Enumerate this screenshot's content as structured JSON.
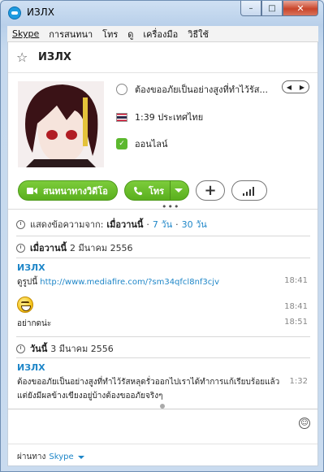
{
  "window": {
    "title": "ИЗЛХ",
    "controls": {
      "minimize": "–",
      "maximize": "□",
      "close": "✕"
    }
  },
  "menu": [
    "Skype",
    "การสนทนา",
    "โทร",
    "ดู",
    "เครื่องมือ",
    "วิธีใช้"
  ],
  "contact": {
    "name": "ИЗЛХ",
    "mood": "ต้องขออภัยเป็นอย่างสูงที่ทำไว้รัส...",
    "local_time": "1:39 ประเทศไทย",
    "status": "ออนไลน์"
  },
  "actions": {
    "video_call": "สนทนาทางวิดีโอ",
    "call": "โทร",
    "add": "+"
  },
  "history": {
    "label": "แสดงข้อความจาก:",
    "selected": "เมื่อวานนี้",
    "opt7": "7 วัน",
    "opt30": "30 วัน"
  },
  "days": [
    {
      "label": "เมื่อวานนี้",
      "date": "2 มีนาคม 2556",
      "sender": "ИЗЛХ",
      "messages": [
        {
          "prefix": "ดูรูปนี้",
          "link": "http://www.mediafire.com/?sm34qfcl8nf3cjv",
          "time": "18:41"
        },
        {
          "emoji": "grin-emoticon",
          "time": "18:41"
        },
        {
          "text": "อย่ากดน่ะ",
          "time": "18:51"
        }
      ]
    },
    {
      "label": "วันนี้",
      "date": "3 มีนาคม 2556",
      "sender": "ИЗЛХ",
      "messages": [
        {
          "text": "ต้องขออภัยเป็นอย่างสูงที่ทำไว้รัสหลุดรั่วออกไปเราได้ทำการแก้เรียบร้อยแล้วแต่ยังมีผลข้างเขียงอยู่บ้างต้องขออภัยจริงๆ",
          "time": "1:32"
        }
      ]
    }
  ],
  "footer": {
    "via_label": "ผ่านทาง",
    "via_value": "Skype"
  },
  "colors": {
    "accent_green": "#5aaf1e",
    "link_blue": "#1e86c8",
    "close_red": "#c9452a"
  }
}
